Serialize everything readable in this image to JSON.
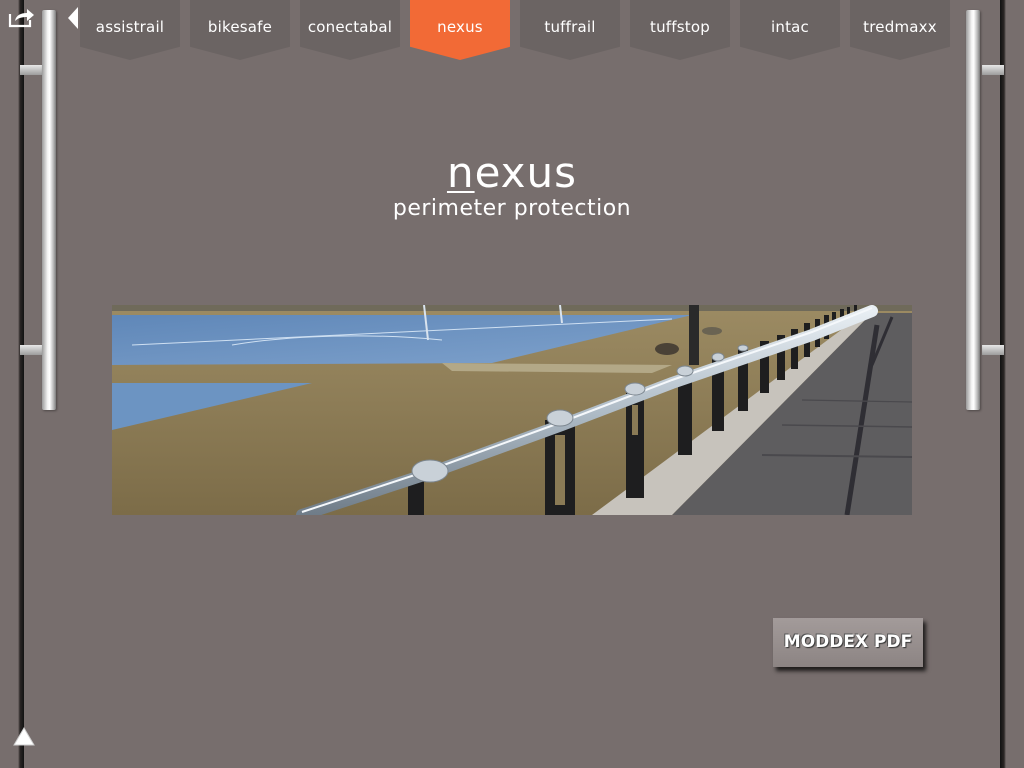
{
  "nav": {
    "tabs": [
      {
        "label": "assistrail",
        "active": false
      },
      {
        "label": "bikesafe",
        "active": false
      },
      {
        "label": "conectabal",
        "active": false
      },
      {
        "label": "nexus",
        "active": true
      },
      {
        "label": "tuffrail",
        "active": false
      },
      {
        "label": "tuffstop",
        "active": false
      },
      {
        "label": "intac",
        "active": false
      },
      {
        "label": "tredmaxx",
        "active": false
      }
    ]
  },
  "product": {
    "title_first": "n",
    "title_rest": "exus",
    "subtitle": "perimeter protection"
  },
  "actions": {
    "pdf_button_label": "MODDEX PDF"
  },
  "icons": {
    "share": "share-icon",
    "back": "back-arrow-icon",
    "up": "up-arrow-icon"
  },
  "colors": {
    "background": "#776e6d",
    "tab": "#6b6463",
    "tab_active": "#f26a36",
    "text": "#ffffff"
  }
}
